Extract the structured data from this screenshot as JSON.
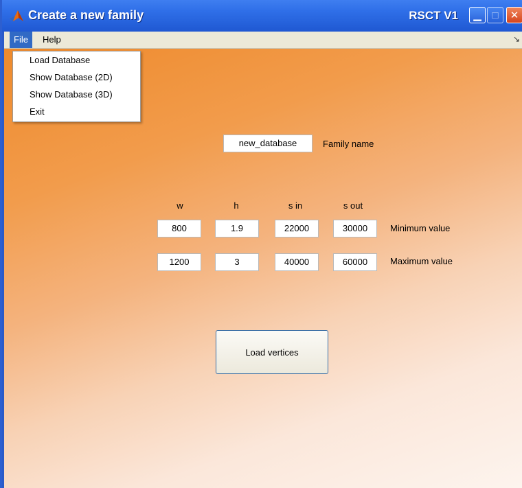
{
  "window": {
    "title": "Create a new family",
    "app_label": "RSCT V1",
    "buttons": {
      "minimize": "minimize-icon",
      "maximize": "maximize-icon",
      "close": "close-icon"
    }
  },
  "menubar": {
    "file": "File",
    "help": "Help"
  },
  "file_menu": {
    "items": [
      "Load Database",
      "Show Database (2D)",
      "Show Database (3D)",
      "Exit"
    ]
  },
  "family": {
    "name_value": "new_database",
    "name_label": "Family name"
  },
  "params": {
    "headers": [
      "w",
      "h",
      "s in",
      "s out"
    ],
    "minimum": [
      "800",
      "1.9",
      "22000",
      "30000"
    ],
    "maximum": [
      "1200",
      "3",
      "40000",
      "60000"
    ],
    "min_label": "Minimum value",
    "max_label": "Maximum value"
  },
  "actions": {
    "load_vertices": "Load vertices"
  },
  "colors": {
    "titlebar": "#2f6fe8",
    "menubar": "#ece9d8",
    "accent": "#ee8a2c"
  }
}
